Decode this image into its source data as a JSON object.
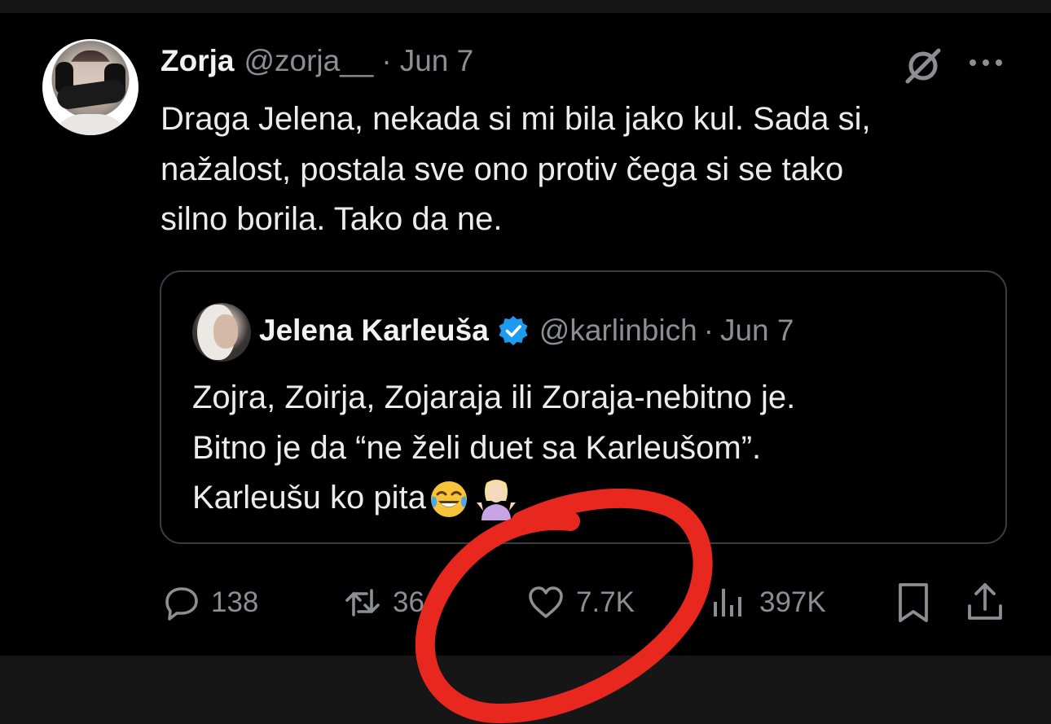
{
  "tweet": {
    "author_name": "Zorja",
    "handle": "@zorja__",
    "separator": "·",
    "date": "Jun 7",
    "text": "Draga Jelena, nekada si mi bila jako kul. Sada si,\nnažalost, postala sve ono protiv čega si se tako\nsilno borila. Tako da ne."
  },
  "quoted_tweet": {
    "author_name": "Jelena Karleuša",
    "handle": "@karlinbich",
    "separator": "·",
    "date": "Jun 7",
    "text": "Zojra, Zoirja, Zojaraja ili Zoraja-nebitno je.\nBitno je da “ne želi duet sa Karleušom”.\nKarleušu ko pita",
    "emojis": [
      "face-with-tears-of-joy",
      "person-shrugging"
    ]
  },
  "actions": {
    "replies": "138",
    "reposts": "36",
    "likes": "7.7K",
    "views": "397K"
  },
  "icons": {
    "reply": "reply-icon",
    "repost": "repost-icon",
    "like": "heart-icon",
    "views": "views-icon",
    "bookmark": "bookmark-icon",
    "share": "share-icon",
    "grok": "grok-icon",
    "more": "more-icon",
    "verified": "verified-badge-icon"
  },
  "colors": {
    "background": "#000000",
    "text": "#e7e9ea",
    "muted": "#8b8f94",
    "verified_blue": "#1d9bf0",
    "annotation_red": "#e8281f"
  }
}
